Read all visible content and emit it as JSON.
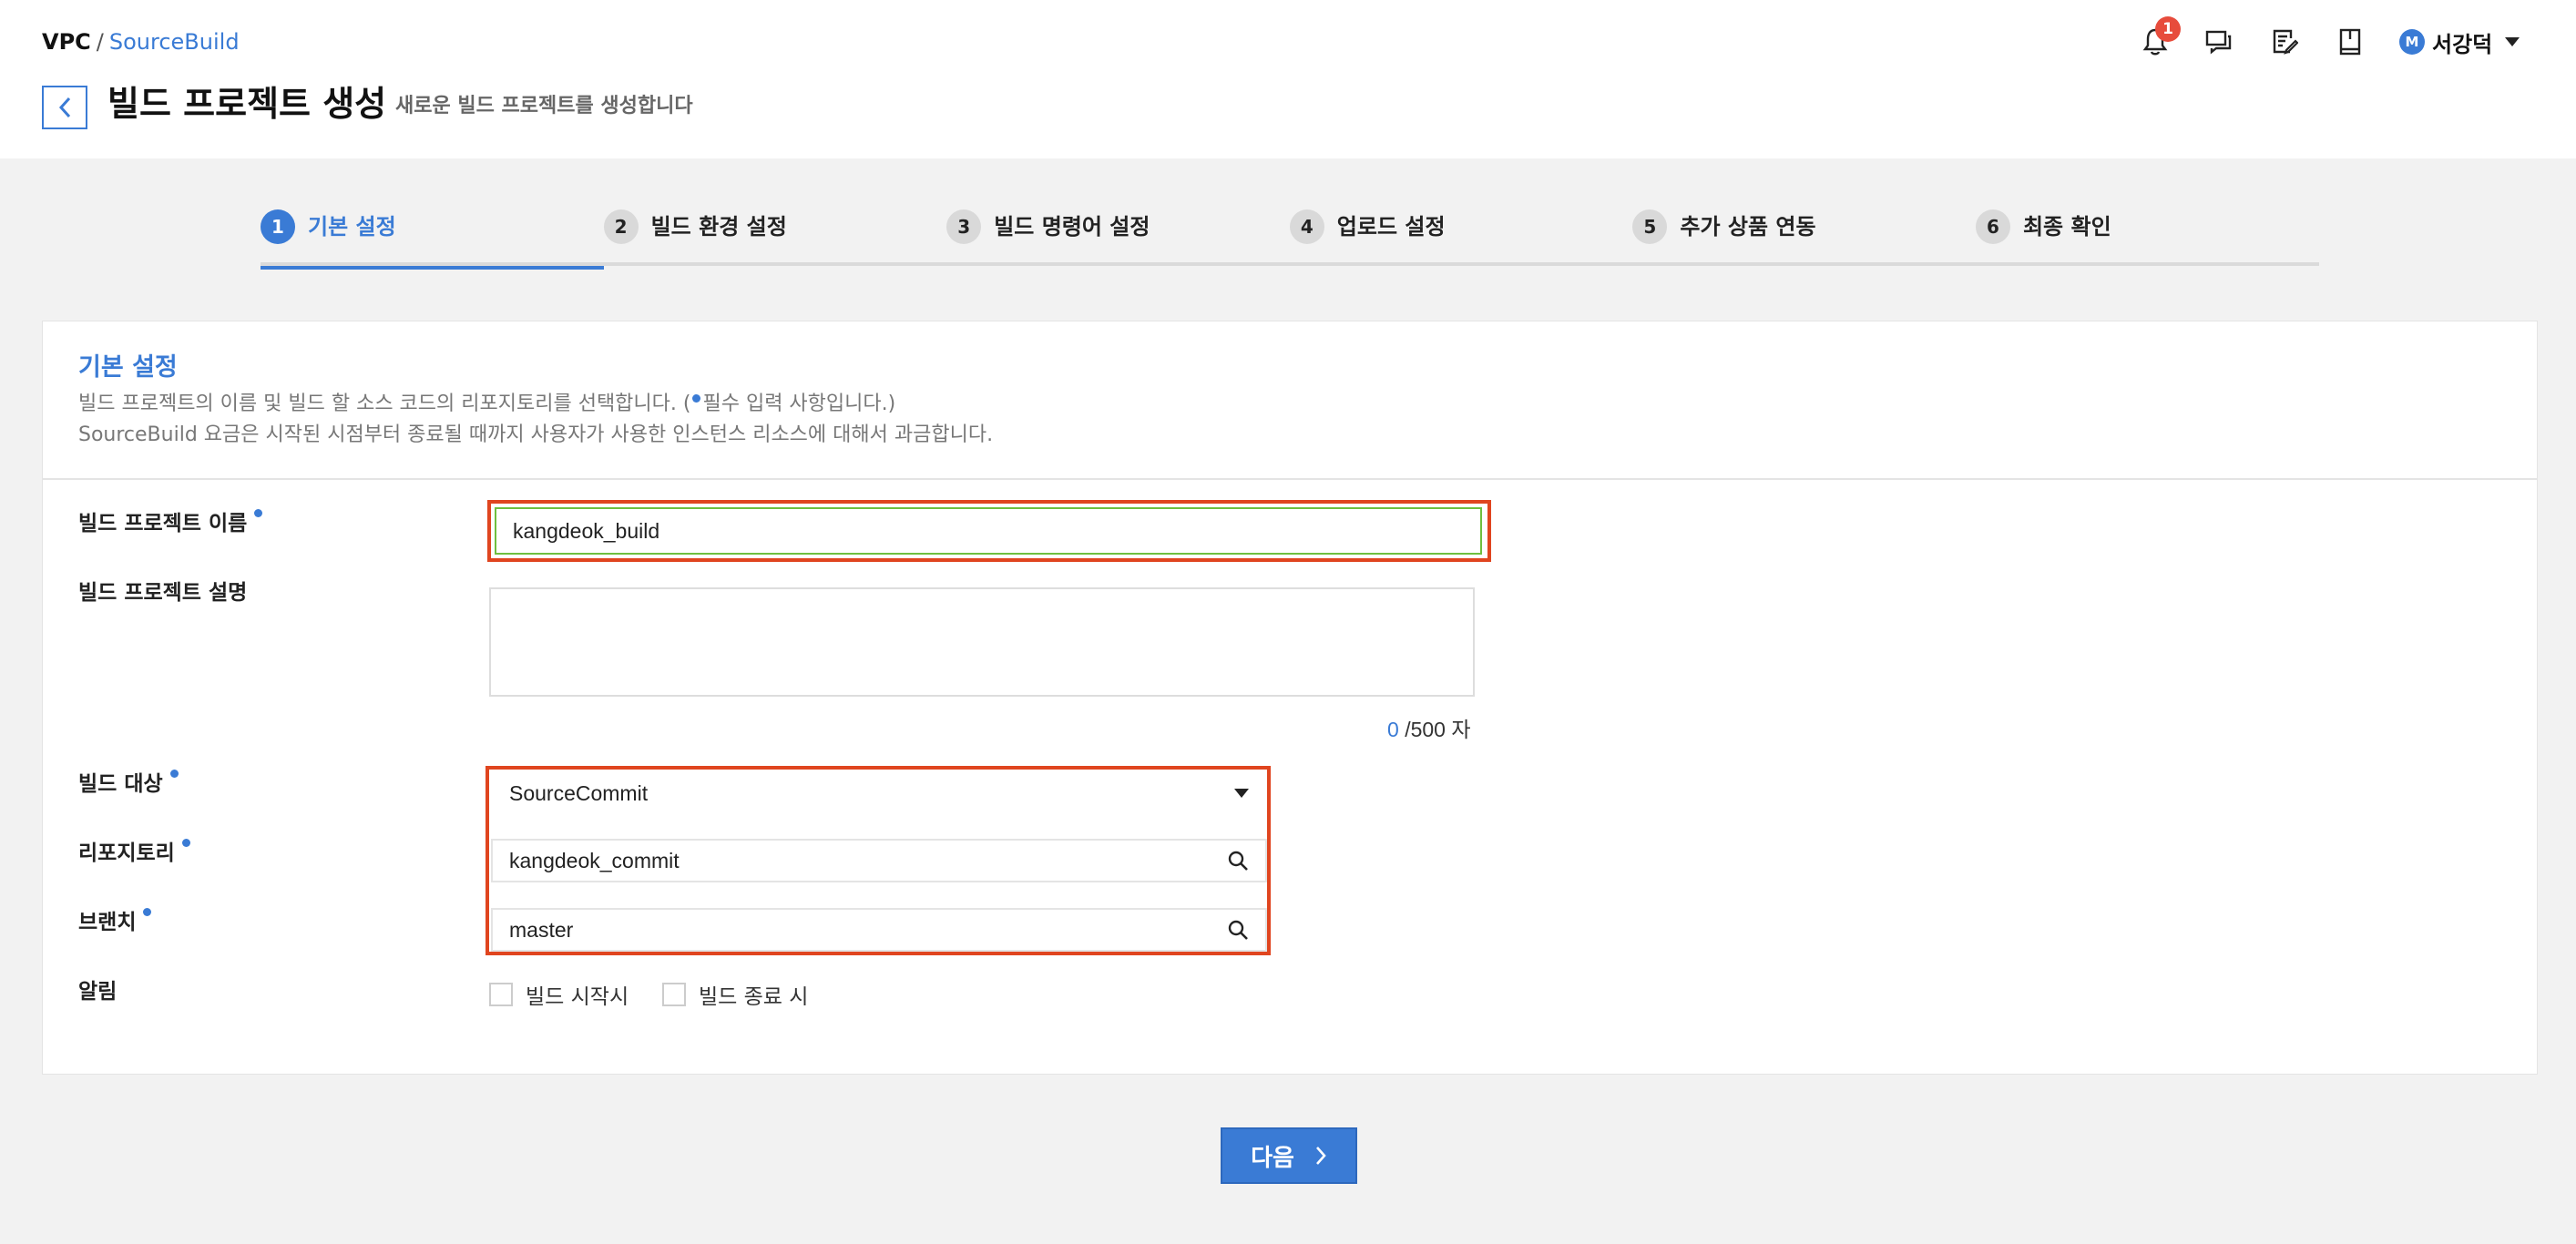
{
  "breadcrumb": {
    "root": "VPC",
    "separator": "/",
    "current": "SourceBuild"
  },
  "page": {
    "title": "빌드 프로젝트 생성",
    "subtitle": "새로운 빌드 프로젝트를 생성합니다"
  },
  "header": {
    "notification_count": "1",
    "icons": [
      "bell-icon",
      "chat-icon",
      "memo-icon",
      "book-icon"
    ],
    "user": {
      "initial": "M",
      "name": "서강덕"
    }
  },
  "steps": [
    {
      "num": "1",
      "label": "기본 설정",
      "active": true
    },
    {
      "num": "2",
      "label": "빌드 환경 설정",
      "active": false
    },
    {
      "num": "3",
      "label": "빌드 명령어 설정",
      "active": false
    },
    {
      "num": "4",
      "label": "업로드 설정",
      "active": false
    },
    {
      "num": "5",
      "label": "추가 상품 연동",
      "active": false
    },
    {
      "num": "6",
      "label": "최종 확인",
      "active": false
    }
  ],
  "section": {
    "title": "기본 설정",
    "desc1_a": "빌드 프로젝트의 이름 및 빌드 할 소스 코드의 리포지토리를 선택합니다. (",
    "desc1_b": "필수 입력 사항입니다.)",
    "desc2": "SourceBuild 요금은 시작된 시점부터 종료될 때까지 사용자가 사용한 인스턴스 리소스에 대해서 과금합니다."
  },
  "form": {
    "name_label": "빌드 프로젝트 이름",
    "name_value": "kangdeok_build",
    "desc_label": "빌드 프로젝트 설명",
    "desc_value": "",
    "char_count": "0",
    "char_limit": "/500 자",
    "target_label": "빌드 대상",
    "target_value": "SourceCommit",
    "repo_label": "리포지토리",
    "repo_value": "kangdeok_commit",
    "branch_label": "브랜치",
    "branch_value": "master",
    "notify_label": "알림",
    "notify_start": "빌드 시작시",
    "notify_end": "빌드 종료 시"
  },
  "next_button": "다음",
  "colors": {
    "accent": "#3a7bd5",
    "highlight": "#e0451f",
    "valid": "#6fbf3f",
    "badge": "#e74c3c"
  }
}
